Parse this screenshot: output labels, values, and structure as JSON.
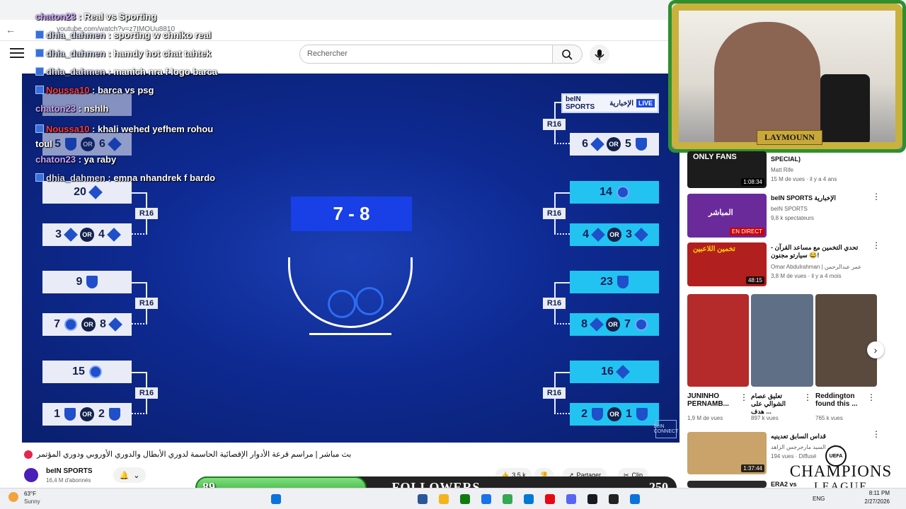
{
  "browser": {
    "url": "youtube.com/watch?v=z7IMOUu8810"
  },
  "search": {
    "placeholder": "Rechercher"
  },
  "chat": [
    {
      "user": "chaton23",
      "message": "Real vs Sporting",
      "color": "chat"
    },
    {
      "user": "dhia_dahmen",
      "message": "sporting w chniko real",
      "color": "dhia"
    },
    {
      "user": "dhia_dahmen",
      "message": "hamdy hot chat tahtek",
      "color": "dhia"
    },
    {
      "user": "dhia_dahmen",
      "message": "manich nra f logo barca",
      "color": "dhia"
    },
    {
      "user": "Noussa10",
      "message": "barca vs psg",
      "color": "nou"
    },
    {
      "user": "chaton23",
      "message": "nshlh",
      "color": "chat"
    },
    {
      "user": "Noussa10",
      "message": "khali wehed yefhem rohou toul",
      "color": "nou"
    },
    {
      "user": "chaton23",
      "message": "ya raby",
      "color": "chat"
    },
    {
      "user": "dhia_dahmen",
      "message": "emna nhandrek f bardo",
      "color": "dhia"
    }
  ],
  "bracket": {
    "round_label": "R16",
    "or_label": "OR",
    "left": [
      {
        "top": "20",
        "pair": [
          "3",
          "4"
        ]
      },
      {
        "top": "9",
        "pair": [
          "7",
          "8"
        ]
      },
      {
        "top": "15",
        "pair": [
          "1",
          "2"
        ]
      }
    ],
    "left_partial_pair": [
      "5",
      "6"
    ],
    "right": [
      {
        "top": "",
        "pair": [
          "6",
          "5"
        ]
      },
      {
        "top": "14",
        "pair": [
          "4",
          "3"
        ]
      },
      {
        "top": "23",
        "pair": [
          "8",
          "7"
        ]
      },
      {
        "top": "16",
        "pair": [
          "2",
          "1"
        ]
      }
    ],
    "draw_result": "7 - 8"
  },
  "overlay": {
    "bein_live": "LIVE",
    "bein_brand": "beIN SPORTS",
    "bein_arabic": "الإخبارية",
    "bein_connect": "beIN CONNECT"
  },
  "streamer": {
    "name": "LAYMOUNN"
  },
  "sidebar": {
    "items": [
      {
        "title": "SPECIAL)",
        "channel": "Matt Rife",
        "meta": "15 M de vues · il y a 4 ans",
        "duration": "1:08:34",
        "thumb_text": "ONLY FANS",
        "color": "#1a1a1a"
      },
      {
        "title": "beIN SPORTS الإخبارية",
        "channel": "beIN SPORTS",
        "meta": "9,8 k spectateurs",
        "duration": "EN DIRECT",
        "thumb_text": "المباشر",
        "color": "#6b2a9a"
      },
      {
        "title": "تحدي التخمين مع مساعد القرآن - سيارتو مجنون 😂!",
        "channel": "Omar Abdulrahman | عمر عبدالرحمن",
        "meta": "3,8 M de vues · il y a 4 mois",
        "duration": "48:15",
        "thumb_text": "تخمين اللاعبين",
        "color": "#b21f1f"
      }
    ],
    "shorts": [
      {
        "title": "JUNINHO PERNAMB...",
        "views": "1,9 M de vues"
      },
      {
        "title": "تعليق عصام الشوالي على هدف ...",
        "views": "897 k vues"
      },
      {
        "title": "Reddington found this ...",
        "views": "765 k vues"
      }
    ],
    "bottom_items": [
      {
        "title": "قداس السابق تعدينيه",
        "channel": "قداس السيد مارجرجس الزاهد",
        "meta": "194 vues · Diffusé",
        "duration": "1:37:44"
      },
      {
        "title": "ERA2 vs MESSA...",
        "channel": "",
        "meta": "",
        "duration": ""
      }
    ]
  },
  "video": {
    "title": "بث مباشر | مراسم قرعة الأدوار الإقصائية الحاسمة لدوري الأبطال والدوري الأوروبي ودوري المؤتمر",
    "channel": "beIN SPORTS",
    "subscribers": "16,4 M d'abonnés",
    "likes": "3,5 k",
    "share": "Partager",
    "clip": "Clip"
  },
  "followers": {
    "current": "89",
    "label": "FOLLOWERS",
    "goal": "250",
    "progress": 0.356
  },
  "ucl": {
    "uefa": "UEFA",
    "line1": "CHAMPIONS",
    "line2": "LEAGUE"
  },
  "taskbar": {
    "temp": "63°F",
    "weather": "Sunny",
    "lang": "ENG",
    "time": "8:11 PM",
    "date": "2/27/2026"
  }
}
